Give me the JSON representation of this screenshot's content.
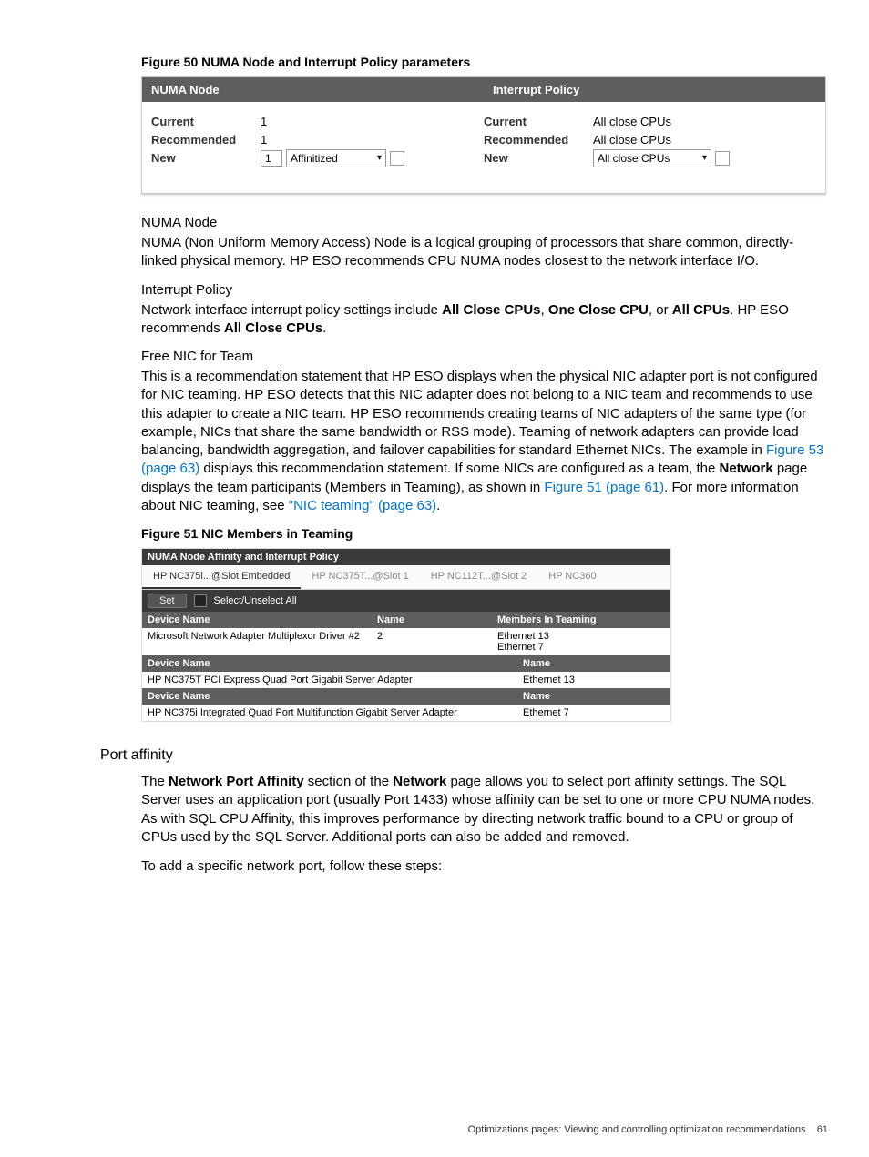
{
  "figure50": {
    "caption": "Figure 50 NUMA Node and Interrupt Policy parameters",
    "header_left": "NUMA Node",
    "header_right": "Interrupt Policy",
    "labels": {
      "current": "Current",
      "recommended": "Recommended",
      "new": "New"
    },
    "numa": {
      "current": "1",
      "recommended": "1",
      "new_input": "1",
      "new_select": "Affinitized"
    },
    "interrupt": {
      "current": "All close CPUs",
      "recommended": "All close CPUs",
      "new_select": "All close CPUs"
    }
  },
  "text": {
    "numa_label": "NUMA Node",
    "numa_para": "NUMA (Non Uniform Memory Access) Node is a logical grouping of processors that share common, directly-linked physical memory. HP ESO recommends CPU NUMA nodes closest to the network interface I/O.",
    "ip_label": "Interrupt Policy",
    "ip_pre": "Network interface interrupt policy settings include ",
    "ip_b1": "All Close CPUs",
    "ip_mid1": ", ",
    "ip_b2": "One Close CPU",
    "ip_mid2": ", or ",
    "ip_b3": "All CPUs",
    "ip_post1": ". HP ESO recommends ",
    "ip_b4": "All Close CPUs",
    "ip_post2": ".",
    "fn_label": "Free NIC for Team",
    "fn_p1": "This is a recommendation statement that HP ESO displays when the physical NIC adapter port is not configured for NIC teaming. HP ESO detects that this NIC adapter does not belong to a NIC team and recommends to use this adapter to create a NIC team. HP ESO recommends creating teams of NIC adapters of the same type (for example, NICs that share the same bandwidth or RSS mode). Teaming of network adapters can provide load balancing, bandwidth aggregation, and failover capabilities for standard Ethernet NICs. The example in ",
    "fn_link1": "Figure 53 (page 63)",
    "fn_p2": " displays this recommendation statement. If some NICs are configured as a team, the ",
    "fn_b1": "Network",
    "fn_p3": " page displays the team participants (Members in Teaming), as shown in ",
    "fn_link2": "Figure 51 (page 61)",
    "fn_p4": ". For more information about NIC teaming, see ",
    "fn_link3": "\"NIC teaming\" (page 63)",
    "fn_p5": "."
  },
  "figure51": {
    "caption": "Figure 51 NIC Members in Teaming",
    "panel_title": "NUMA Node Affinity and Interrupt Policy",
    "tabs": [
      "HP NC375i...@Slot Embedded",
      "HP NC375T...@Slot 1",
      "HP NC112T...@Slot 2",
      "HP NC360"
    ],
    "active_tab": 0,
    "set_label": "Set",
    "select_all": "Select/Unselect All",
    "hdr_device": "Device Name",
    "hdr_name": "Name",
    "hdr_members": "Members In Teaming",
    "row1_device": "Microsoft Network Adapter Multiplexor Driver #2",
    "row1_name": "2",
    "row1_members_a": "Ethernet 13",
    "row1_members_b": "Ethernet 7",
    "sec2_device": "HP NC375T PCI Express Quad Port Gigabit Server Adapter",
    "sec2_name": "Ethernet 13",
    "sec3_device": "HP NC375i Integrated Quad Port Multifunction Gigabit Server Adapter",
    "sec3_name": "Ethernet 7"
  },
  "port_affinity": {
    "heading": "Port affinity",
    "p1_pre": "The ",
    "p1_b1": "Network Port Affinity",
    "p1_mid1": " section of the ",
    "p1_b2": "Network",
    "p1_post": " page allows you to select port affinity settings. The SQL Server uses an application port (usually Port 1433) whose affinity can be set to one or more CPU NUMA nodes. As with SQL CPU Affinity, this improves performance by directing network traffic bound to a CPU or group of CPUs used by the SQL Server. Additional ports can also be added and removed.",
    "p2": "To add a specific network port, follow these steps:"
  },
  "footer": {
    "text": "Optimizations pages: Viewing and controlling optimization recommendations",
    "page": "61"
  }
}
